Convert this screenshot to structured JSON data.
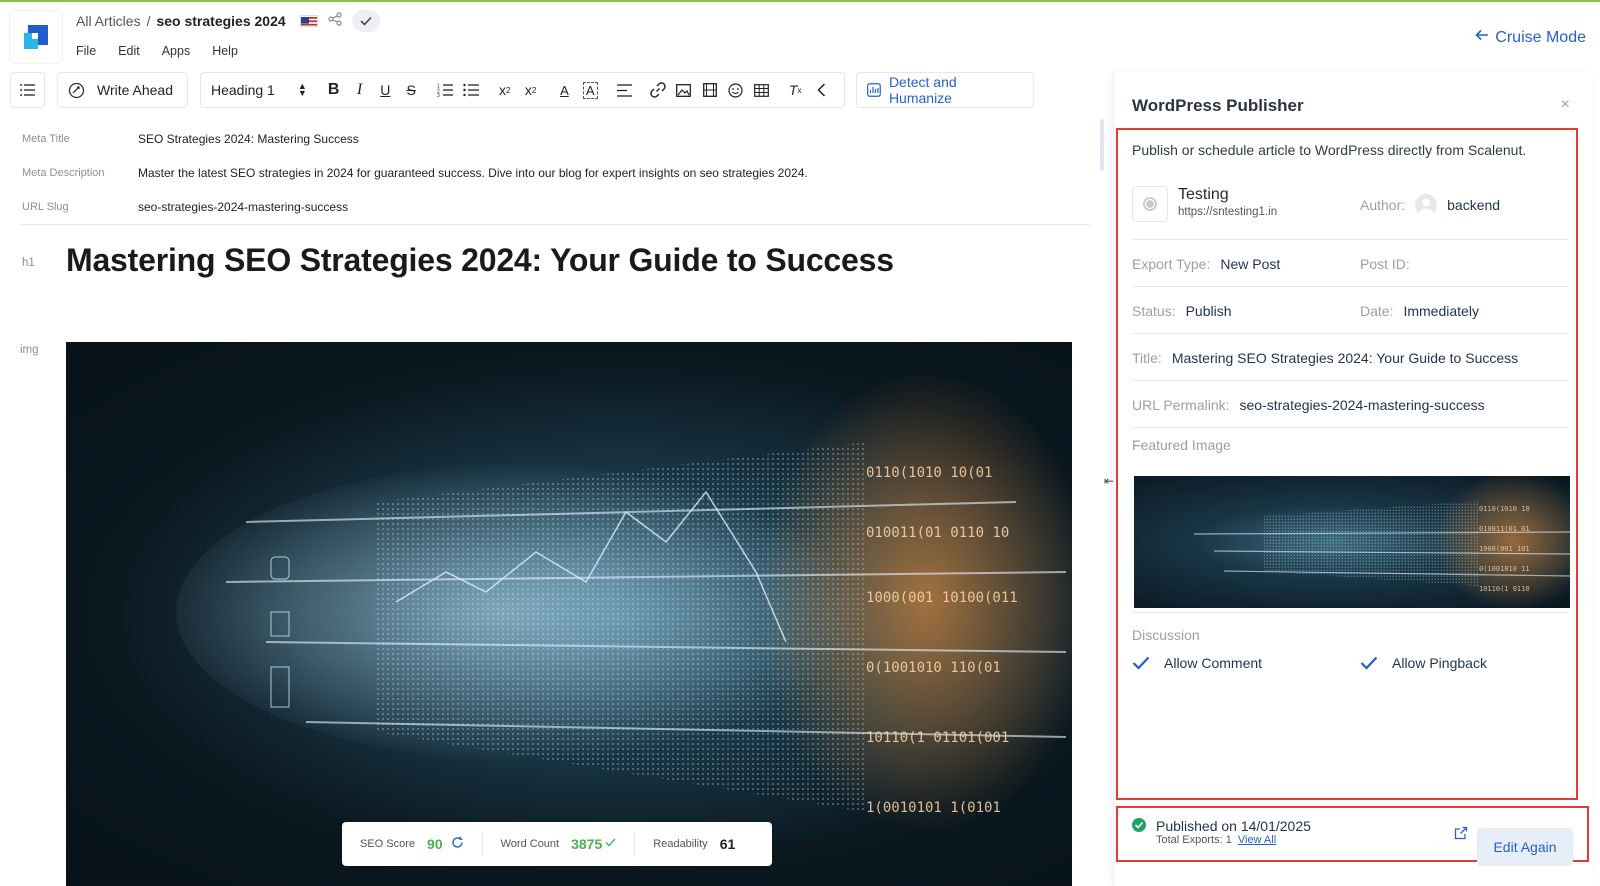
{
  "header": {
    "breadcrumb_root": "All Articles",
    "breadcrumb_sep": "/",
    "breadcrumb_current": "seo strategies 2024",
    "menus": [
      "File",
      "Edit",
      "Apps",
      "Help"
    ],
    "cruise_mode": "Cruise Mode"
  },
  "toolbar": {
    "write_ahead": "Write Ahead",
    "heading_select": "Heading 1",
    "detect_humanize": "Detect and Humanize"
  },
  "meta": {
    "title_label": "Meta Title",
    "title_value": "SEO Strategies 2024: Mastering Success",
    "desc_label": "Meta Description",
    "desc_value": "Master the latest SEO strategies in 2024 for guaranteed success. Dive into our blog for expert insights on seo strategies 2024.",
    "slug_label": "URL Slug",
    "slug_value": "seo-strategies-2024-mastering-success"
  },
  "content": {
    "h1_tag": "h1",
    "h1_text": "Mastering SEO Strategies 2024: Your Guide to Success",
    "img_tag": "img"
  },
  "scores": {
    "seo_label": "SEO Score",
    "seo_value": "90",
    "word_label": "Word Count",
    "word_value": "3875",
    "read_label": "Readability",
    "read_value": "61"
  },
  "panel": {
    "title": "WordPress Publisher",
    "close": "×",
    "intro": "Publish or schedule article to WordPress directly from Scalenut.",
    "site_name": "Testing",
    "site_url": "https://sntesting1.in",
    "author_label": "Author:",
    "author_value": "backend",
    "export_type_label": "Export Type:",
    "export_type_value": "New Post",
    "post_id_label": "Post ID:",
    "status_label": "Status:",
    "status_value": "Publish",
    "date_label": "Date:",
    "date_value": "Immediately",
    "title_label": "Title:",
    "title_value": "Mastering SEO Strategies 2024: Your Guide to Success",
    "permalink_label": "URL Permalink:",
    "permalink_value": "seo-strategies-2024-mastering-success",
    "featured_label": "Featured Image",
    "discussion_label": "Discussion",
    "allow_comment": "Allow Comment",
    "allow_pingback": "Allow Pingback",
    "published": "Published on 14/01/2025",
    "total_exports": "Total Exports: 1",
    "view_all": "View All",
    "edit_again": "Edit Again"
  },
  "colors": {
    "accent": "#2563c9",
    "highlight_border": "#e53935",
    "success": "#22a06b",
    "score_green": "#4caf50"
  }
}
